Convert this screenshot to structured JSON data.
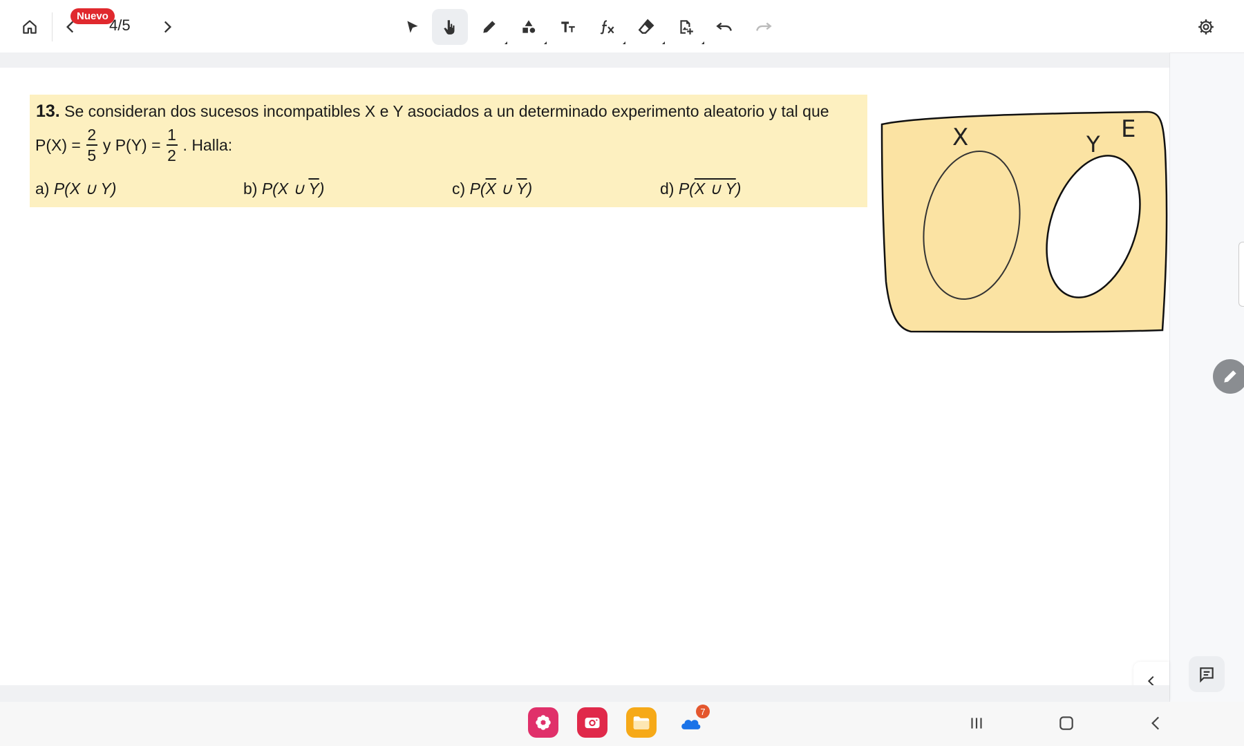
{
  "toolbar": {
    "badge": "Nuevo",
    "page_indicator": "4/5",
    "tools": [
      "select-icon",
      "hand-icon",
      "pen-icon",
      "shapes-icon",
      "text-icon",
      "formula-icon",
      "eraser-icon",
      "insert-image-icon",
      "undo-icon",
      "redo-icon"
    ],
    "active_tool": "hand-icon"
  },
  "problem": {
    "number": "13.",
    "text_line1": " Se consideran dos sucesos incompatibles X e Y asociados a un determinado experimento aleatorio y tal que",
    "px_label": "P(X) =",
    "px_num": "2",
    "px_den": "5",
    "py_label": "y P(Y) =",
    "py_num": "1",
    "py_den": "2",
    "halla": ". Halla:",
    "options": {
      "a_label": "a)",
      "a_expr": "P(X ∪ Y)",
      "b_label": "b)",
      "b_expr_pre": "P(X ∪ ",
      "b_expr_bar": "Y",
      "b_expr_post": ")",
      "c_label": "c)",
      "c_expr_pre": "P(",
      "c_expr_bar1": "X",
      "c_expr_mid": " ∪ ",
      "c_expr_bar2": "Y",
      "c_expr_post": ")",
      "d_label": "d)",
      "d_expr_pre": "P(",
      "d_expr_bar": "X ∪ Y",
      "d_expr_post": ")"
    }
  },
  "sketch": {
    "label_x": "X",
    "label_y": "Y",
    "label_e": "E",
    "fill_color": "#fbe3a3"
  },
  "dock": {
    "apps": [
      "flower-app-icon",
      "camera-app-icon",
      "folder-app-icon",
      "cloud-app-icon"
    ],
    "cloud_badge": "7"
  },
  "colors": {
    "accent_red": "#e0292e",
    "highlight": "#fdf0c0"
  }
}
